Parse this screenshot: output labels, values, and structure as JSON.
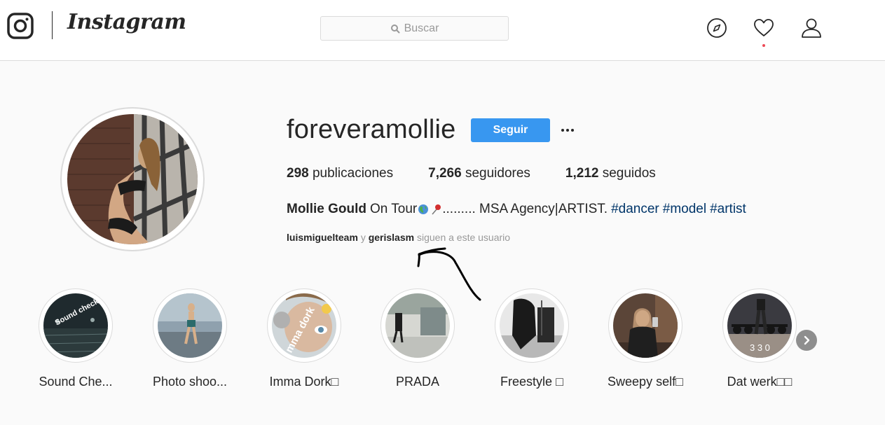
{
  "header": {
    "brand": "Instagram",
    "search_placeholder": "Buscar",
    "icons": [
      "instagram-glyph-icon",
      "search-icon",
      "compass-icon",
      "heart-icon",
      "person-icon"
    ],
    "notification_dot": "#ed4956"
  },
  "profile": {
    "username": "foreveramollie",
    "follow_label": "Seguir",
    "stats": {
      "posts_count": "298",
      "posts_label": "publicaciones",
      "followers_count": "7,266",
      "followers_label": "seguidores",
      "following_count": "1,212",
      "following_label": "seguidos"
    },
    "bio": {
      "name": "Mollie Gould",
      "text_a": "On Tour",
      "text_b": "......... MSA Agency|ARTIST.",
      "emojis": [
        "globe-icon",
        "pushpin-icon"
      ],
      "hashtags": [
        "#dancer",
        "#model",
        "#artist"
      ]
    },
    "followed_by": {
      "account_1": "luismiguelteam",
      "connector": "y",
      "account_2": "gerislasm",
      "suffix": "siguen a este usuario"
    }
  },
  "highlights": [
    {
      "label": "Sound Che...",
      "overlay": "Sound check"
    },
    {
      "label": "Photo shoo..."
    },
    {
      "label": "Imma Dork□",
      "overlay": "mma dork"
    },
    {
      "label": "PRADA"
    },
    {
      "label": "Freestyle □"
    },
    {
      "label": "Sweepy self□"
    },
    {
      "label": "Dat werk□□",
      "overlay": "3 3 0"
    }
  ],
  "colors": {
    "accent": "#3897f0",
    "hashtag": "#003569",
    "muted": "#999999",
    "border": "#dbdbdb"
  }
}
